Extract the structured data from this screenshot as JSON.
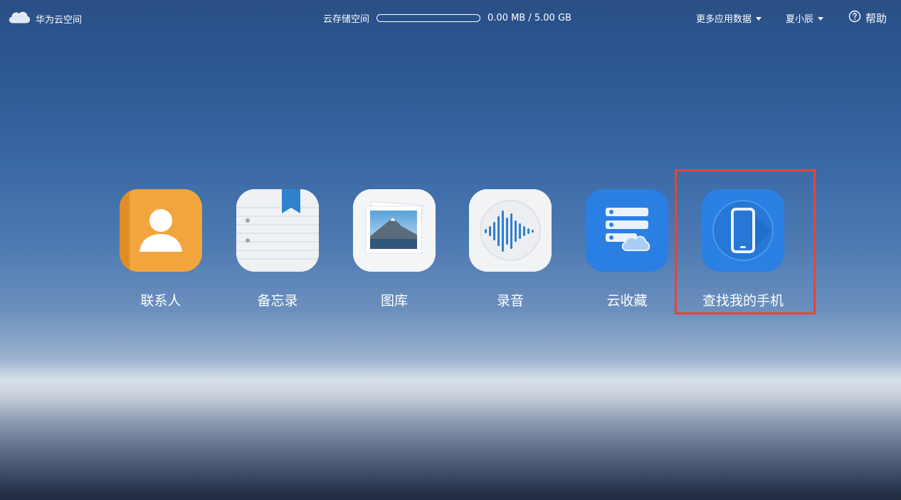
{
  "topbar": {
    "brand_icon": "cloud-icon",
    "brand_label": "华为云空间",
    "storage_label": "云存储空间",
    "storage_used_fraction": 0.0,
    "storage_usage": "0.00 MB / 5.00 GB",
    "more_data_label": "更多应用数据",
    "user_label": "夏小辰",
    "help_label": "帮助"
  },
  "apps": [
    {
      "label": "联系人",
      "icon": "contacts-icon",
      "color": "#f1a23b"
    },
    {
      "label": "备忘录",
      "icon": "notes-icon",
      "color": "#eef0f3"
    },
    {
      "label": "图库",
      "icon": "gallery-icon",
      "color": "#f4f5f7"
    },
    {
      "label": "录音",
      "icon": "recorder-icon",
      "color": "#f1f2f4"
    },
    {
      "label": "云收藏",
      "icon": "cloud-favorites-icon",
      "color": "#2f86e8"
    },
    {
      "label": "查找我的手机",
      "icon": "find-my-phone-icon",
      "color": "#2f86e8"
    }
  ]
}
